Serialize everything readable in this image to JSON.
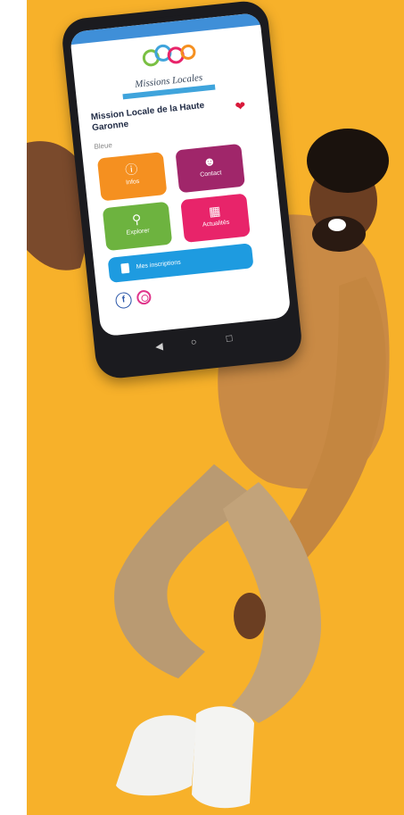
{
  "image": {
    "background_color": "#f7b12a",
    "accent_colors": {
      "info": "#f59020",
      "contact": "#a0266a",
      "explore": "#6db33f",
      "news": "#e8246a",
      "signup": "#1e9be0",
      "favorite": "#d8193a"
    }
  },
  "phone": {
    "logo_text": "Missions Locales",
    "app_title": "Mission Locale de la Haute Garonne",
    "subtitle": "Bleue",
    "tiles": [
      {
        "label": "Infos",
        "icon": "info-icon"
      },
      {
        "label": "Contact",
        "icon": "people-icon"
      },
      {
        "label": "Explorer",
        "icon": "search-icon"
      },
      {
        "label": "Actualités",
        "icon": "calendar-icon"
      }
    ],
    "signup_label": "Mes inscriptions",
    "social": [
      {
        "icon": "facebook-icon"
      },
      {
        "icon": "instagram-icon"
      }
    ]
  }
}
